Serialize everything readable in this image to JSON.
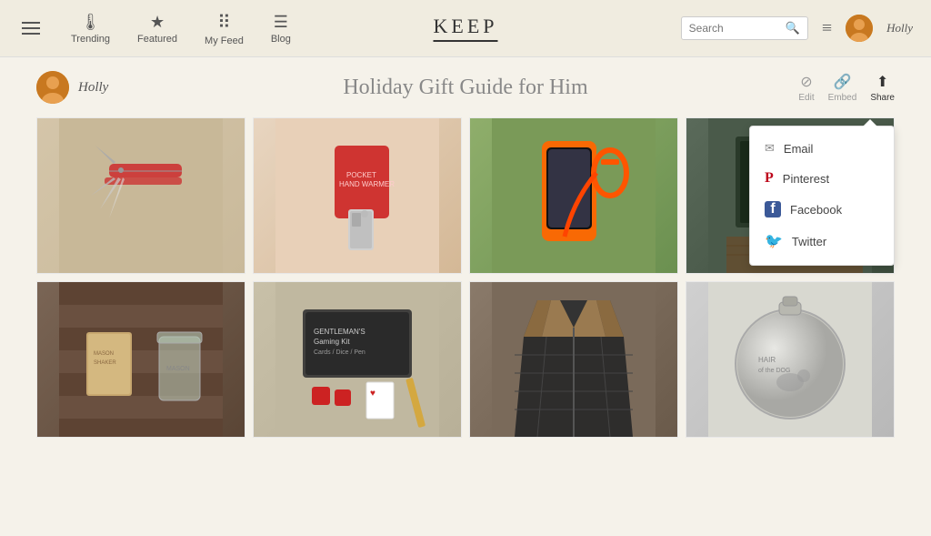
{
  "navbar": {
    "hamburger_label": "menu",
    "nav_items": [
      {
        "id": "trending",
        "label": "Trending",
        "icon": "🌡"
      },
      {
        "id": "featured",
        "label": "Featured",
        "icon": "★"
      },
      {
        "id": "myfeed",
        "label": "My Feed",
        "icon": "⠿"
      },
      {
        "id": "blog",
        "label": "Blog",
        "icon": "☰"
      }
    ],
    "logo": "KEEP",
    "search_placeholder": "Search",
    "user_name": "Holly"
  },
  "page": {
    "user_name": "Holly",
    "title": "Holiday Gift Guide for Him",
    "actions": {
      "edit": "Edit",
      "embed": "Embed",
      "share": "Share"
    },
    "share_menu": {
      "items": [
        {
          "id": "email",
          "label": "Email",
          "icon": "✉"
        },
        {
          "id": "pinterest",
          "label": "Pinterest",
          "icon": "P"
        },
        {
          "id": "facebook",
          "label": "Facebook",
          "icon": "f"
        },
        {
          "id": "twitter",
          "label": "Twitter",
          "icon": "t"
        }
      ]
    }
  },
  "grid": {
    "items": [
      {
        "id": 1,
        "alt": "Swiss Army Knife / Multi-tool"
      },
      {
        "id": 2,
        "alt": "Pocket Hand Warmer"
      },
      {
        "id": 3,
        "alt": "iPhone Case with Carabiner"
      },
      {
        "id": 4,
        "alt": "Chalkboard / Writing board"
      },
      {
        "id": 5,
        "alt": "Mason Jar and Journal"
      },
      {
        "id": 6,
        "alt": "Gaming Kit - Cards, Dice, Pen"
      },
      {
        "id": 7,
        "alt": "Quilted Vest - Brown/Black"
      },
      {
        "id": 8,
        "alt": "Hair of the Dog Flask"
      }
    ]
  }
}
